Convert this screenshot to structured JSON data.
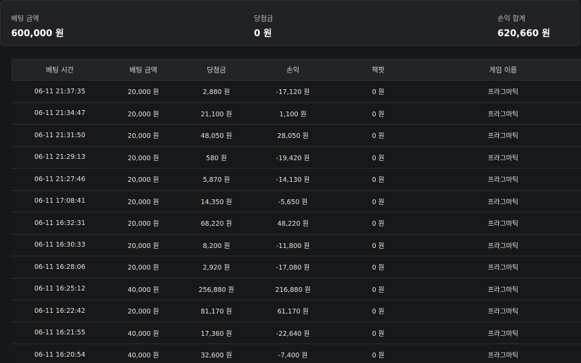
{
  "summary": {
    "bet_amount_label": "베팅 금액",
    "bet_amount_value": "600,000 원",
    "win_label": "당첨금",
    "win_value": "0 원",
    "pnl_label": "손익 합계",
    "pnl_value": "620,660 원"
  },
  "table": {
    "headers": [
      "베팅 시간",
      "베팅 금액",
      "당첨금",
      "손익",
      "잭팟",
      "게임 이름"
    ],
    "rows": [
      [
        "06-11 21:37:35",
        "20,000 원",
        "2,880 원",
        "-17,120 원",
        "0 원",
        "프라그마틱"
      ],
      [
        "06-11 21:34:47",
        "20,000 원",
        "21,100 원",
        "1,100 원",
        "0 원",
        "프라그마틱"
      ],
      [
        "06-11 21:31:50",
        "20,000 원",
        "48,050 원",
        "28,050 원",
        "0 원",
        "프라그마틱"
      ],
      [
        "06-11 21:29:13",
        "20,000 원",
        "580 원",
        "-19,420 원",
        "0 원",
        "프라그마틱"
      ],
      [
        "06-11 21:27:46",
        "20,000 원",
        "5,870 원",
        "-14,130 원",
        "0 원",
        "프라그마틱"
      ],
      [
        "06-11 17:08:41",
        "20,000 원",
        "14,350 원",
        "-5,650 원",
        "0 원",
        "프라그마틱"
      ],
      [
        "06-11 16:32:31",
        "20,000 원",
        "68,220 원",
        "48,220 원",
        "0 원",
        "프라그마틱"
      ],
      [
        "06-11 16:30:33",
        "20,000 원",
        "8,200 원",
        "-11,800 원",
        "0 원",
        "프라그마틱"
      ],
      [
        "06-11 16:28:06",
        "20,000 원",
        "2,920 원",
        "-17,080 원",
        "0 원",
        "프라그마틱"
      ],
      [
        "06-11 16:25:12",
        "40,000 원",
        "256,880 원",
        "216,880 원",
        "0 원",
        "프라그마틱"
      ],
      [
        "06-11 16:22:42",
        "20,000 원",
        "81,170 원",
        "61,170 원",
        "0 원",
        "프라그마틱"
      ],
      [
        "06-11 16:21:55",
        "40,000 원",
        "17,360 원",
        "-22,640 원",
        "0 원",
        "프라그마틱"
      ],
      [
        "06-11 16:20:54",
        "40,000 원",
        "32,600 원",
        "-7,400 원",
        "0 원",
        "프라그마틱"
      ]
    ]
  }
}
